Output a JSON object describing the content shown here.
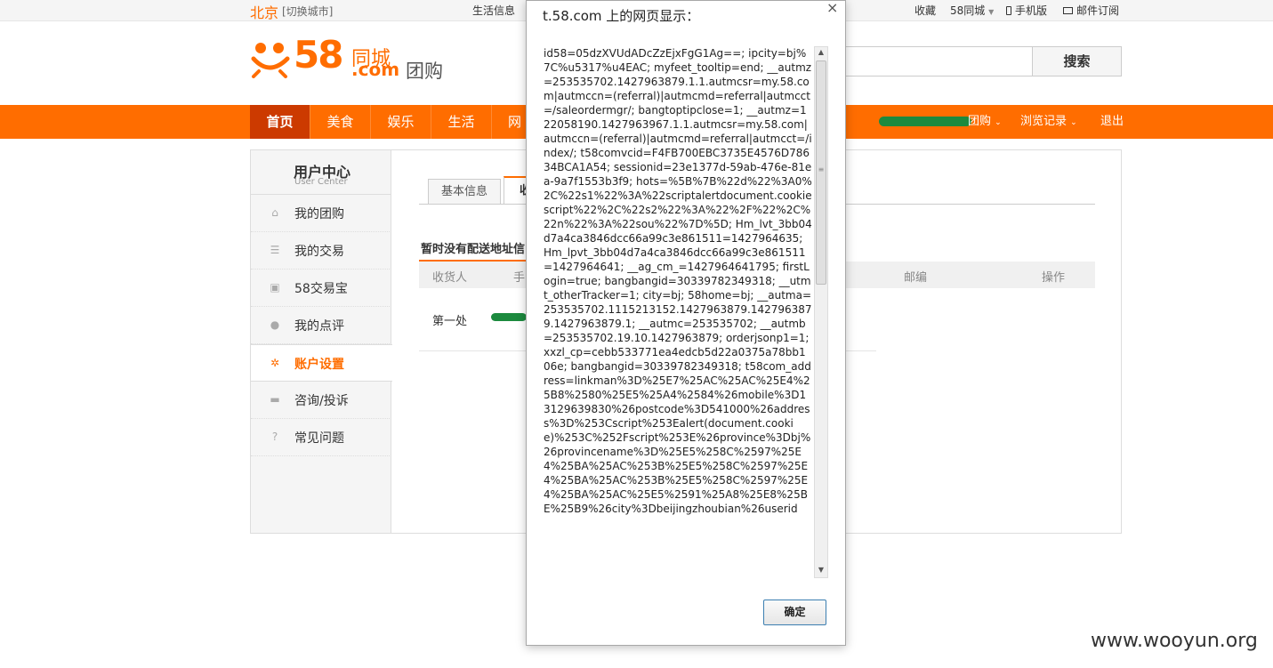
{
  "topbar": {
    "city": "北京",
    "switch_city": "[切换城市]",
    "life_info": "生活信息",
    "favorite": "收藏",
    "city58": "58同城",
    "mobile": "手机版",
    "mail": "邮件订阅"
  },
  "header": {
    "logo_number": "58",
    "logo_tongcheng": "同城",
    "logo_com": ".com",
    "product": "团购",
    "search_button": "搜索",
    "search_value": ""
  },
  "nav": {
    "items": [
      "首页",
      "美食",
      "娱乐",
      "生活",
      "网"
    ],
    "right_suffix": "团购",
    "history": "浏览记录",
    "logout": "退出"
  },
  "sidebar": {
    "title": "用户中心",
    "subtitle": "User Center",
    "items": [
      {
        "label": "我的团购",
        "icon": "home-icon"
      },
      {
        "label": "我的交易",
        "icon": "list-icon"
      },
      {
        "label": "58交易宝",
        "icon": "wallet-icon"
      },
      {
        "label": "我的点评",
        "icon": "comment-icon"
      },
      {
        "label": "账户设置",
        "icon": "gear-icon"
      },
      {
        "label": "咨询/投诉",
        "icon": "message-icon"
      },
      {
        "label": "常见问题",
        "icon": "question-icon"
      }
    ]
  },
  "content": {
    "tabs": [
      "基本信息",
      "收"
    ],
    "notice": "暂时没有配送地址信",
    "columns": {
      "receiver": "收货人",
      "phone": "手",
      "zip": "邮编",
      "action": "操作"
    },
    "row": {
      "receiver": "第一处"
    }
  },
  "dialog": {
    "title": "t.58.com 上的网页显示：",
    "close": "×",
    "ok": "确定",
    "text": "id58=05dzXVUdADcZzEjxFgG1Ag==; ipcity=bj%7C%u5317%u4EAC; myfeet_tooltip=end; __autmz=253535702.1427963879.1.1.autmcsr=my.58.com|autmccn=(referral)|autmcmd=referral|autmcct=/saleordermgr/; bangtoptipclose=1; __autmz=122058190.1427963967.1.1.autmcsr=my.58.com|autmccn=(referral)|autmcmd=referral|autmcct=/index/; t58comvcid=F4FB700EBC3735E4576D78634BCA1A54; sessionid=23e1377d-59ab-476e-81ea-9a7f1553b3f9; hots=%5B%7B%22d%22%3A0%2C%22s1%22%3A%22scriptalertdocument.cookiescript%22%2C%22s2%22%3A%22%2F%22%2C%22n%22%3A%22sou%22%7D%5D; Hm_lvt_3bb04d7a4ca3846dcc66a99c3e861511=1427964635; Hm_lpvt_3bb04d7a4ca3846dcc66a99c3e861511=1427964641; __ag_cm_=1427964641795; firstLogin=true; bangbangid=30339782349318; __utmt_otherTracker=1; city=bj; 58home=bj; __autma=253535702.1115213152.1427963879.1427963879.1427963879.1; __autmc=253535702; __autmb=253535702.19.10.1427963879; orderjsonp1=1; xxzl_cp=cebb533771ea4edcb5d22a0375a78bb106e; bangbangid=30339782349318; t58com_address=linkman%3D%25E7%25AC%25AC%25E4%25B8%2580%25E5%25A4%2584%26mobile%3D13129639830%26postcode%3D541000%26address%3D%253Cscript%253Ealert(document.cookie)%253C%252Fscript%253E%26province%3Dbj%26provincename%3D%25E5%258C%2597%25E4%25BA%25AC%253B%25E5%258C%2597%25E4%25BA%25AC%253B%25E5%258C%2597%25E4%25BA%25AC%25E5%2591%25A8%25E8%25BE%25B9%26city%3Dbeijingzhoubian%26userid"
  },
  "watermark": "www.wooyun.org",
  "colors": {
    "brand": "#ff6d00",
    "nav_active": "#cc3a00"
  }
}
